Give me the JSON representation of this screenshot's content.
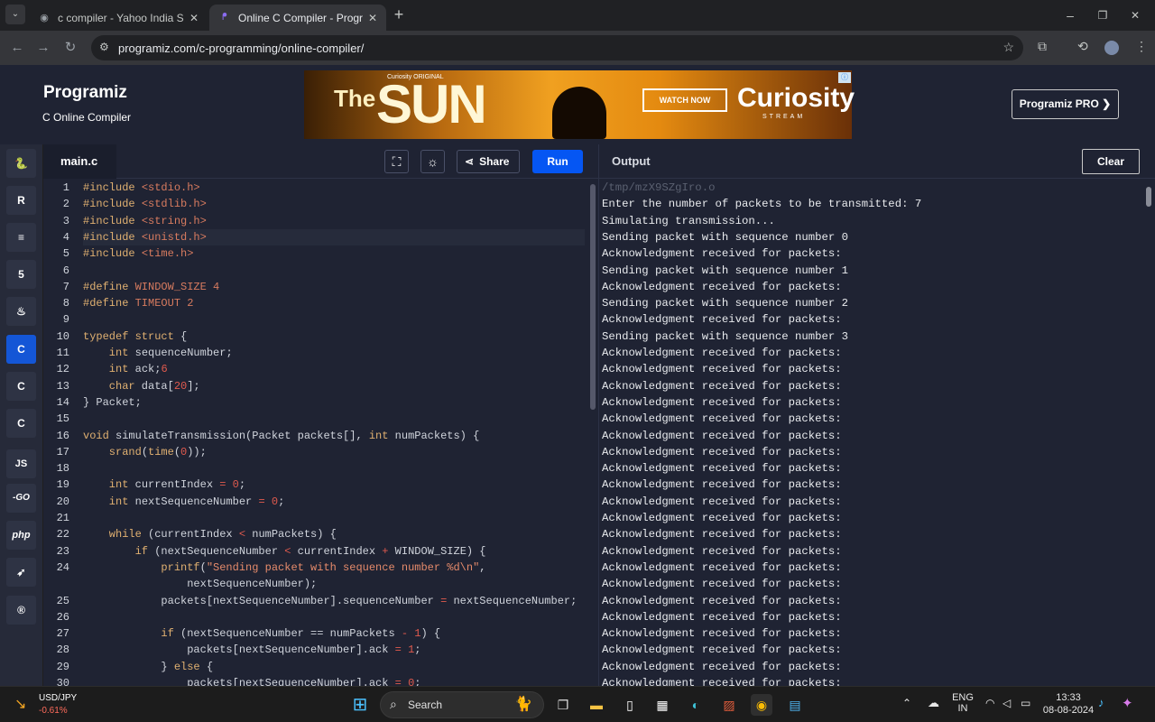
{
  "browser": {
    "tabs": [
      {
        "title": "c compiler - Yahoo India Search",
        "favicon": "yahoo-icon"
      },
      {
        "title": "Online C Compiler - Programiz",
        "favicon": "programiz-icon"
      }
    ],
    "new_tab": "+",
    "url": "programiz.com/c-programming/online-compiler/",
    "window_controls": [
      "–",
      "❐",
      "✕"
    ]
  },
  "site": {
    "logo": "Programiz",
    "subtitle": "C Online Compiler",
    "pro_button": "Programiz PRO ❯",
    "ad": {
      "brand_top": "Curiosity ORIGINAL",
      "the": "The",
      "sun": "SUN",
      "watch_now": "WATCH NOW",
      "curiosity": "Curiosity",
      "stream": "STREAM"
    }
  },
  "sidebar": {
    "languages": [
      {
        "name": "python",
        "glyph": "🐍"
      },
      {
        "name": "r",
        "glyph": "R"
      },
      {
        "name": "sql",
        "glyph": "≡"
      },
      {
        "name": "html",
        "glyph": "5"
      },
      {
        "name": "java",
        "glyph": "♨"
      },
      {
        "name": "c",
        "glyph": "C"
      },
      {
        "name": "cpp",
        "glyph": "C"
      },
      {
        "name": "csharp",
        "glyph": "C"
      },
      {
        "name": "js",
        "glyph": "JS"
      },
      {
        "name": "go",
        "glyph": "-GO"
      },
      {
        "name": "php",
        "glyph": "php"
      },
      {
        "name": "swift",
        "glyph": "➶"
      },
      {
        "name": "rust",
        "glyph": "®"
      }
    ]
  },
  "editor": {
    "file_name": "main.c",
    "share_label": "Share",
    "run_label": "Run",
    "lines": [
      {
        "n": "1",
        "tokens": [
          [
            "k",
            "#include "
          ],
          [
            "p",
            "<stdio.h>"
          ]
        ]
      },
      {
        "n": "2",
        "tokens": [
          [
            "k",
            "#include "
          ],
          [
            "p",
            "<stdlib.h>"
          ]
        ]
      },
      {
        "n": "3",
        "tokens": [
          [
            "k",
            "#include "
          ],
          [
            "p",
            "<string.h>"
          ]
        ]
      },
      {
        "n": "4",
        "tokens": [
          [
            "k",
            "#include "
          ],
          [
            "p",
            "<unistd.h>"
          ]
        ]
      },
      {
        "n": "5",
        "tokens": [
          [
            "k",
            "#include "
          ],
          [
            "p",
            "<time.h>"
          ]
        ]
      },
      {
        "n": "6",
        "tokens": []
      },
      {
        "n": "7",
        "tokens": [
          [
            "k",
            "#define "
          ],
          [
            "p",
            "WINDOW_SIZE 4"
          ]
        ]
      },
      {
        "n": "8",
        "tokens": [
          [
            "k",
            "#define "
          ],
          [
            "p",
            "TIMEOUT 2"
          ]
        ]
      },
      {
        "n": "9",
        "tokens": []
      },
      {
        "n": "10",
        "tokens": [
          [
            "k",
            "typedef struct"
          ],
          [
            "v",
            " {"
          ]
        ]
      },
      {
        "n": "11",
        "tokens": [
          [
            "k",
            "    int"
          ],
          [
            "v",
            " sequenceNumber;"
          ]
        ]
      },
      {
        "n": "12",
        "tokens": [
          [
            "k",
            "    int"
          ],
          [
            "v",
            " ack;"
          ],
          [
            "c",
            "6"
          ]
        ]
      },
      {
        "n": "13",
        "tokens": [
          [
            "k",
            "    char"
          ],
          [
            "v",
            " data["
          ],
          [
            "c",
            "20"
          ],
          [
            "v",
            "];"
          ]
        ]
      },
      {
        "n": "14",
        "tokens": [
          [
            "v",
            "} Packet;"
          ]
        ]
      },
      {
        "n": "15",
        "tokens": []
      },
      {
        "n": "16",
        "tokens": [
          [
            "k",
            "void"
          ],
          [
            "v",
            " simulateTransmission(Packet packets[], "
          ],
          [
            "k",
            "int"
          ],
          [
            "v",
            " numPackets) {"
          ]
        ]
      },
      {
        "n": "17",
        "tokens": [
          [
            "k",
            "    srand"
          ],
          [
            "v",
            "("
          ],
          [
            "k",
            "time"
          ],
          [
            "v",
            "("
          ],
          [
            "c",
            "0"
          ],
          [
            "v",
            "));"
          ]
        ]
      },
      {
        "n": "18",
        "tokens": []
      },
      {
        "n": "19",
        "tokens": [
          [
            "k",
            "    int"
          ],
          [
            "v",
            " currentIndex "
          ],
          [
            "c",
            "="
          ],
          [
            "v",
            " "
          ],
          [
            "c",
            "0"
          ],
          [
            "v",
            ";"
          ]
        ]
      },
      {
        "n": "20",
        "tokens": [
          [
            "k",
            "    int"
          ],
          [
            "v",
            " nextSequenceNumber "
          ],
          [
            "c",
            "="
          ],
          [
            "v",
            " "
          ],
          [
            "c",
            "0"
          ],
          [
            "v",
            ";"
          ]
        ]
      },
      {
        "n": "21",
        "tokens": []
      },
      {
        "n": "22",
        "tokens": [
          [
            "k",
            "    while"
          ],
          [
            "v",
            " (currentIndex "
          ],
          [
            "c",
            "<"
          ],
          [
            "v",
            " numPackets) {"
          ]
        ]
      },
      {
        "n": "23",
        "tokens": [
          [
            "k",
            "        if"
          ],
          [
            "v",
            " (nextSequenceNumber "
          ],
          [
            "c",
            "<"
          ],
          [
            "v",
            " currentIndex "
          ],
          [
            "c",
            "+"
          ],
          [
            "v",
            " WINDOW_SIZE) {"
          ]
        ]
      },
      {
        "n": "24",
        "tokens": [
          [
            "k",
            "            printf"
          ],
          [
            "v",
            "("
          ],
          [
            "s",
            "\"Sending packet with sequence number %d\\n\""
          ],
          [
            "v",
            ","
          ]
        ]
      },
      {
        "n": "",
        "tokens": [
          [
            "v",
            "                nextSequenceNumber);"
          ]
        ]
      },
      {
        "n": "25",
        "tokens": [
          [
            "v",
            "            packets[nextSequenceNumber].sequenceNumber "
          ],
          [
            "c",
            "="
          ],
          [
            "v",
            " nextSequenceNumber;"
          ]
        ]
      },
      {
        "n": "26",
        "tokens": []
      },
      {
        "n": "27",
        "tokens": [
          [
            "k",
            "            if"
          ],
          [
            "v",
            " (nextSequenceNumber == numPackets "
          ],
          [
            "c",
            "-"
          ],
          [
            "v",
            " "
          ],
          [
            "c",
            "1"
          ],
          [
            "v",
            ") {"
          ]
        ]
      },
      {
        "n": "28",
        "tokens": [
          [
            "v",
            "                packets[nextSequenceNumber].ack "
          ],
          [
            "c",
            "="
          ],
          [
            "v",
            " "
          ],
          [
            "c",
            "1"
          ],
          [
            "v",
            ";"
          ]
        ]
      },
      {
        "n": "29",
        "tokens": [
          [
            "v",
            "            } "
          ],
          [
            "k",
            "else"
          ],
          [
            "v",
            " {"
          ]
        ]
      },
      {
        "n": "30",
        "tokens": [
          [
            "v",
            "                packets[nextSequenceNumber].ack "
          ],
          [
            "c",
            "="
          ],
          [
            "v",
            " "
          ],
          [
            "c",
            "0"
          ],
          [
            "v",
            ";"
          ]
        ]
      }
    ]
  },
  "output": {
    "label": "Output",
    "clear_label": "Clear",
    "path": "/tmp/mzX9SZgIro.o",
    "lines": [
      "Enter the number of packets to be transmitted: 7",
      "Simulating transmission...",
      "Sending packet with sequence number 0",
      "Acknowledgment received for packets:",
      "Sending packet with sequence number 1",
      "Acknowledgment received for packets:",
      "Sending packet with sequence number 2",
      "Acknowledgment received for packets:",
      "Sending packet with sequence number 3",
      "Acknowledgment received for packets:",
      "Acknowledgment received for packets:",
      "Acknowledgment received for packets:",
      "Acknowledgment received for packets:",
      "Acknowledgment received for packets:",
      "Acknowledgment received for packets:",
      "Acknowledgment received for packets:",
      "Acknowledgment received for packets:",
      "Acknowledgment received for packets:",
      "Acknowledgment received for packets:",
      "Acknowledgment received for packets:",
      "Acknowledgment received for packets:",
      "Acknowledgment received for packets:",
      "Acknowledgment received for packets:",
      "Acknowledgment received for packets:",
      "Acknowledgment received for packets:",
      "Acknowledgment received for packets:",
      "Acknowledgment received for packets:",
      "Acknowledgment received for packets:",
      "Acknowledgment received for packets:",
      "Acknowledgment received for packets:"
    ]
  },
  "taskbar": {
    "stock_symbol": "USD/JPY",
    "stock_change": "-0.61%",
    "search_label": "Search",
    "lang_top": "ENG",
    "lang_bottom": "IN",
    "time": "13:33",
    "date": "08-08-2024"
  }
}
